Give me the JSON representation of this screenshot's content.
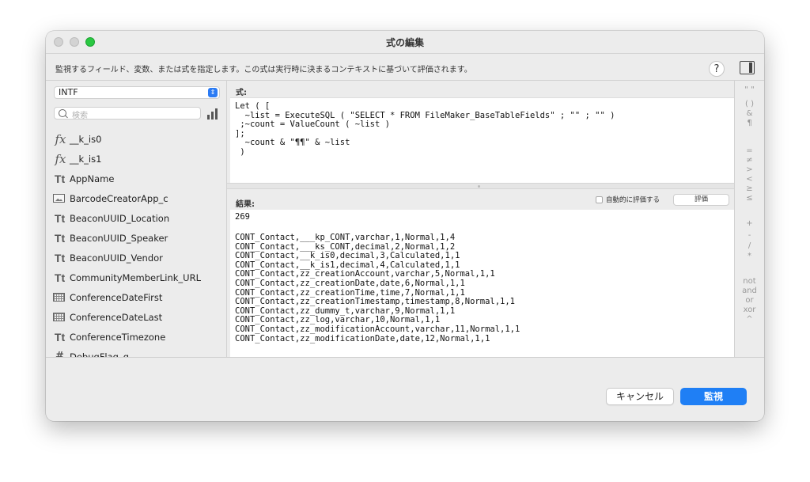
{
  "window": {
    "title": "式の編集",
    "description": "監視するフィールド、変数、または式を指定します。この式は実行時に決まるコンテキストに基づいて評価されます。",
    "help_label": "?"
  },
  "left": {
    "context": "INTF",
    "search_placeholder": "検索",
    "fields": [
      {
        "icon": "fx",
        "name": "__k_is0"
      },
      {
        "icon": "fx",
        "name": "__k_is1"
      },
      {
        "icon": "Tt",
        "name": "AppName"
      },
      {
        "icon": "image",
        "name": "BarcodeCreatorApp_c"
      },
      {
        "icon": "Tt",
        "name": "BeaconUUID_Location"
      },
      {
        "icon": "Tt",
        "name": "BeaconUUID_Speaker"
      },
      {
        "icon": "Tt",
        "name": "BeaconUUID_Vendor"
      },
      {
        "icon": "Tt",
        "name": "CommunityMemberLink_URL"
      },
      {
        "icon": "date",
        "name": "ConferenceDateFirst"
      },
      {
        "icon": "date",
        "name": "ConferenceDateLast"
      },
      {
        "icon": "Tt",
        "name": "ConferenceTimezone"
      },
      {
        "icon": "#",
        "name": "DebugFlag_g"
      }
    ]
  },
  "formula": {
    "label": "式:",
    "text": "Let ( [\n  ~list = ExecuteSQL ( \"SELECT * FROM FileMaker_BaseTableFields\" ; \"\" ; \"\" )\n ;~count = ValueCount ( ~list )\n];\n  ~count & \"¶¶\" & ~list\n )"
  },
  "result": {
    "label": "結果:",
    "auto_eval_label": "自動的に評価する",
    "eval_button": "評価",
    "value": "269",
    "lines": "CONT_Contact,___kp_CONT,varchar,1,Normal,1,4\nCONT_Contact,___ks_CONT,decimal,2,Normal,1,2\nCONT_Contact,__k_is0,decimal,3,Calculated,1,1\nCONT_Contact,__k_is1,decimal,4,Calculated,1,1\nCONT_Contact,zz_creationAccount,varchar,5,Normal,1,1\nCONT_Contact,zz_creationDate,date,6,Normal,1,1\nCONT_Contact,zz_creationTime,time,7,Normal,1,1\nCONT_Contact,zz_creationTimestamp,timestamp,8,Normal,1,1\nCONT_Contact,zz_dummy_t,varchar,9,Normal,1,1\nCONT_Contact,zz_log,varchar,10,Normal,1,1\nCONT_Contact,zz_modificationAccount,varchar,11,Normal,1,1\nCONT_Contact,zz_modificationDate,date,12,Normal,1,1"
  },
  "operators": [
    "\" \"",
    "( )",
    "&",
    "¶",
    "=",
    "≠",
    ">",
    "<",
    "≥",
    "≤",
    "+",
    "-",
    "/",
    "*",
    "not",
    "and",
    "or",
    "xor",
    "^"
  ],
  "buttons": {
    "cancel": "キャンセル",
    "watch": "監視"
  },
  "colors": {
    "accent": "#1f7ff5",
    "traffic_green": "#2ac842"
  }
}
